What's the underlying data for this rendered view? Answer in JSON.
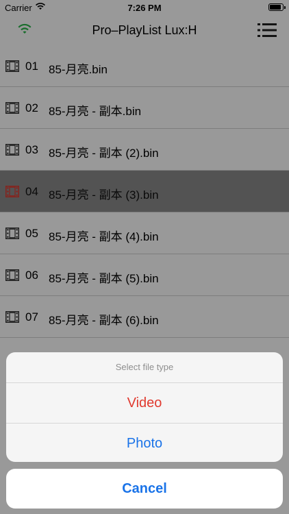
{
  "status_bar": {
    "carrier": "Carrier",
    "time": "7:26 PM"
  },
  "nav": {
    "title": "Pro–PlayList Lux:H"
  },
  "colors": {
    "accent_blue": "#1a73e8",
    "destructive_red": "#e03a2f",
    "wifi_green": "#2db84d"
  },
  "playlist": [
    {
      "num": "01",
      "name": "85-月亮.bin",
      "selected": false
    },
    {
      "num": "02",
      "name": "85-月亮 - 副本.bin",
      "selected": false
    },
    {
      "num": "03",
      "name": "85-月亮 - 副本 (2).bin",
      "selected": false
    },
    {
      "num": "04",
      "name": "85-月亮 - 副本 (3).bin",
      "selected": true
    },
    {
      "num": "05",
      "name": "85-月亮 - 副本 (4).bin",
      "selected": false
    },
    {
      "num": "06",
      "name": "85-月亮 - 副本 (5).bin",
      "selected": false
    },
    {
      "num": "07",
      "name": "85-月亮 - 副本 (6).bin",
      "selected": false
    }
  ],
  "action_sheet": {
    "title": "Select file type",
    "options": [
      {
        "label": "Video",
        "color": "#e03a2f"
      },
      {
        "label": "Photo",
        "color": "#1a73e8"
      }
    ],
    "cancel_label": "Cancel"
  }
}
